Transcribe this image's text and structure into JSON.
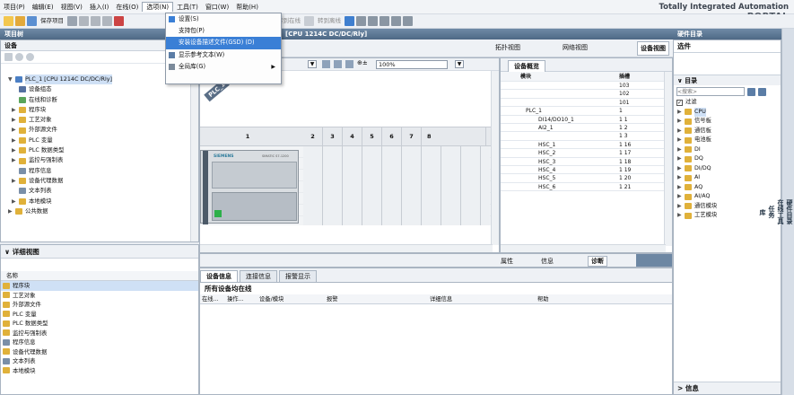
{
  "menubar": {
    "items": [
      "项目(P)",
      "编辑(E)",
      "视图(V)",
      "插入(I)",
      "在线(O)",
      "选项(N)",
      "工具(T)",
      "窗口(W)",
      "帮助(H)"
    ],
    "brand_line1": "Totally Integrated Automation",
    "brand_line2": "PORTAL"
  },
  "toolbar": {
    "save_label": "保存项目",
    "go_online": "转到在线",
    "go_offline": "转到离线"
  },
  "options_menu": {
    "items": [
      "设置(S)",
      "支持包(P)",
      "安装设备描述文件(GSD) (D)",
      "显示参考文本(W)",
      "全局库(G)"
    ]
  },
  "project_tree": {
    "title": "项目树",
    "section": "设备",
    "items": [
      "PLC_1 [CPU 1214C DC/DC/Rly]",
      "设备组态",
      "在线和诊断",
      "程序块",
      "工艺对象",
      "外部源文件",
      "PLC 变量",
      "PLC 数据类型",
      "监控与强制表",
      "程序信息",
      "设备代理数据",
      "文本列表",
      "本地模块",
      "公共数据"
    ]
  },
  "detail_view": {
    "title": "详细视图",
    "col_name": "名称",
    "items": [
      "程序块",
      "工艺对象",
      "外部源文件",
      "PLC 变量",
      "PLC 数据类型",
      "监控与强制表",
      "程序信息",
      "设备代理数据",
      "文本列表",
      "本地模块"
    ]
  },
  "editor": {
    "title_suffix": "[CPU 1214C DC/DC/Rly]",
    "views": [
      "拓扑视图",
      "网络视图",
      "设备视图"
    ],
    "zoom": "100%",
    "plc_label": "PLC_1",
    "rack_slots": [
      "1",
      "2",
      "3",
      "4",
      "5",
      "6",
      "7",
      "8"
    ],
    "brand_on_module": "SIEMENS",
    "module_text": "SIMATIC S7-1200"
  },
  "device_overview": {
    "tab": "设备概览",
    "col_module": "模块",
    "col_slot": "插槽",
    "rows": [
      {
        "name": "",
        "slot": "103"
      },
      {
        "name": "",
        "slot": "102"
      },
      {
        "name": "",
        "slot": "101"
      },
      {
        "name": "PLC_1",
        "slot": "1"
      },
      {
        "name": "DI14/DO10_1",
        "slot": "1 1"
      },
      {
        "name": "AI2_1",
        "slot": "1 2"
      },
      {
        "name": "",
        "slot": "1 3"
      },
      {
        "name": "HSC_1",
        "slot": "1 16"
      },
      {
        "name": "HSC_2",
        "slot": "1 17"
      },
      {
        "name": "HSC_3",
        "slot": "1 18"
      },
      {
        "name": "HSC_4",
        "slot": "1 19"
      },
      {
        "name": "HSC_5",
        "slot": "1 20"
      },
      {
        "name": "HSC_6",
        "slot": "1 21"
      }
    ]
  },
  "inspector": {
    "tabs": [
      "属性",
      "信息",
      "诊断"
    ],
    "subtabs": [
      "设备信息",
      "连接信息",
      "报警显示"
    ],
    "status": "所有设备均在线",
    "cols": [
      "在线...",
      "操作...",
      "设备/模块",
      "报警",
      "详细信息",
      "帮助"
    ]
  },
  "catalog": {
    "title": "硬件目录",
    "section": "选件",
    "dir": "目录",
    "search_placeholder": "<搜索>",
    "filter": "过滤",
    "items": [
      "CPU",
      "信号板",
      "通信板",
      "电池板",
      "DI",
      "DQ",
      "DI/DQ",
      "AI",
      "AQ",
      "AI/AQ",
      "通信模块",
      "工艺模块"
    ],
    "footer": "信息",
    "side_tabs": [
      "硬件目录",
      "在线工具",
      "任务",
      "库"
    ]
  },
  "colors": {
    "header": "#4e6985",
    "highlight": "#3a7fd6",
    "folder": "#e0b13a"
  }
}
